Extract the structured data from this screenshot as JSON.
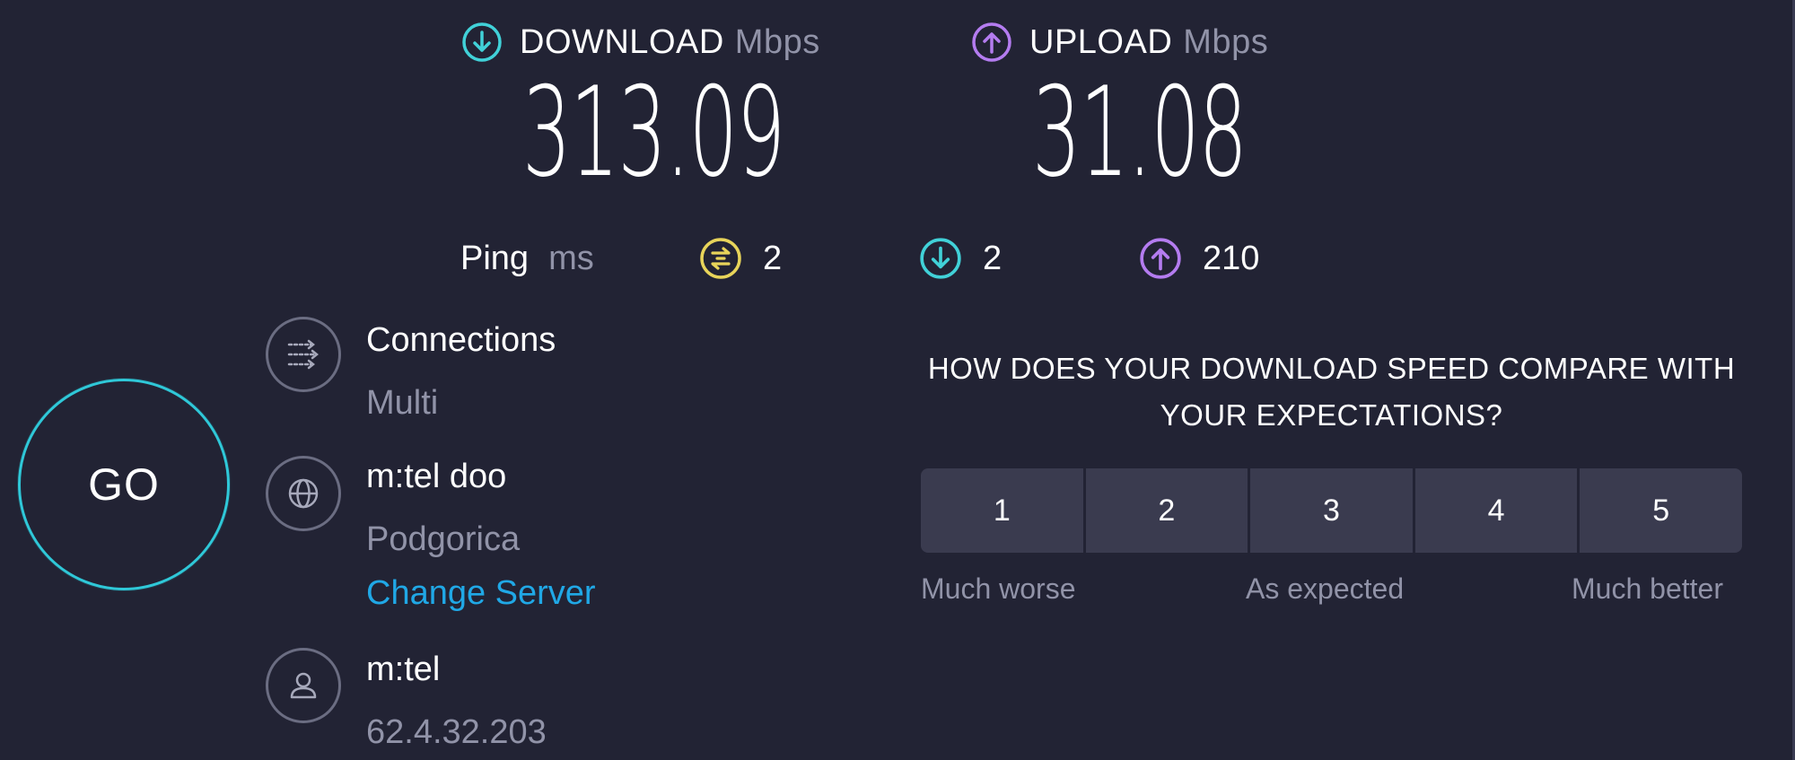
{
  "download": {
    "label": "DOWNLOAD",
    "unit": "Mbps",
    "value": "313.09",
    "icon": "download-arrow-icon",
    "color": "#41d1d8"
  },
  "upload": {
    "label": "UPLOAD",
    "unit": "Mbps",
    "value": "31.08",
    "icon": "upload-arrow-icon",
    "color": "#b47cf0"
  },
  "ping": {
    "label": "Ping",
    "unit": "ms",
    "idle": {
      "value": "2",
      "icon": "ping-jitter-icon",
      "color": "#e8d45a"
    },
    "download": {
      "value": "2",
      "icon": "download-arrow-icon",
      "color": "#41d1d8"
    },
    "upload": {
      "value": "210",
      "icon": "upload-arrow-icon",
      "color": "#b47cf0"
    }
  },
  "go_button": {
    "label": "GO",
    "color": "#2fc8d8"
  },
  "connections": {
    "title": "Connections",
    "value": "Multi",
    "icon": "connections-icon"
  },
  "server": {
    "title": "m:tel doo",
    "location": "Podgorica",
    "change_label": "Change Server",
    "icon": "globe-icon",
    "link_color": "#20a8e6"
  },
  "provider": {
    "title": "m:tel",
    "ip": "62.4.32.203",
    "icon": "user-icon"
  },
  "survey": {
    "question": "HOW DOES YOUR DOWNLOAD SPEED COMPARE WITH YOUR EXPECTATIONS?",
    "options": [
      "1",
      "2",
      "3",
      "4",
      "5"
    ],
    "scale_low": "Much worse",
    "scale_mid": "As expected",
    "scale_high": "Much better"
  }
}
